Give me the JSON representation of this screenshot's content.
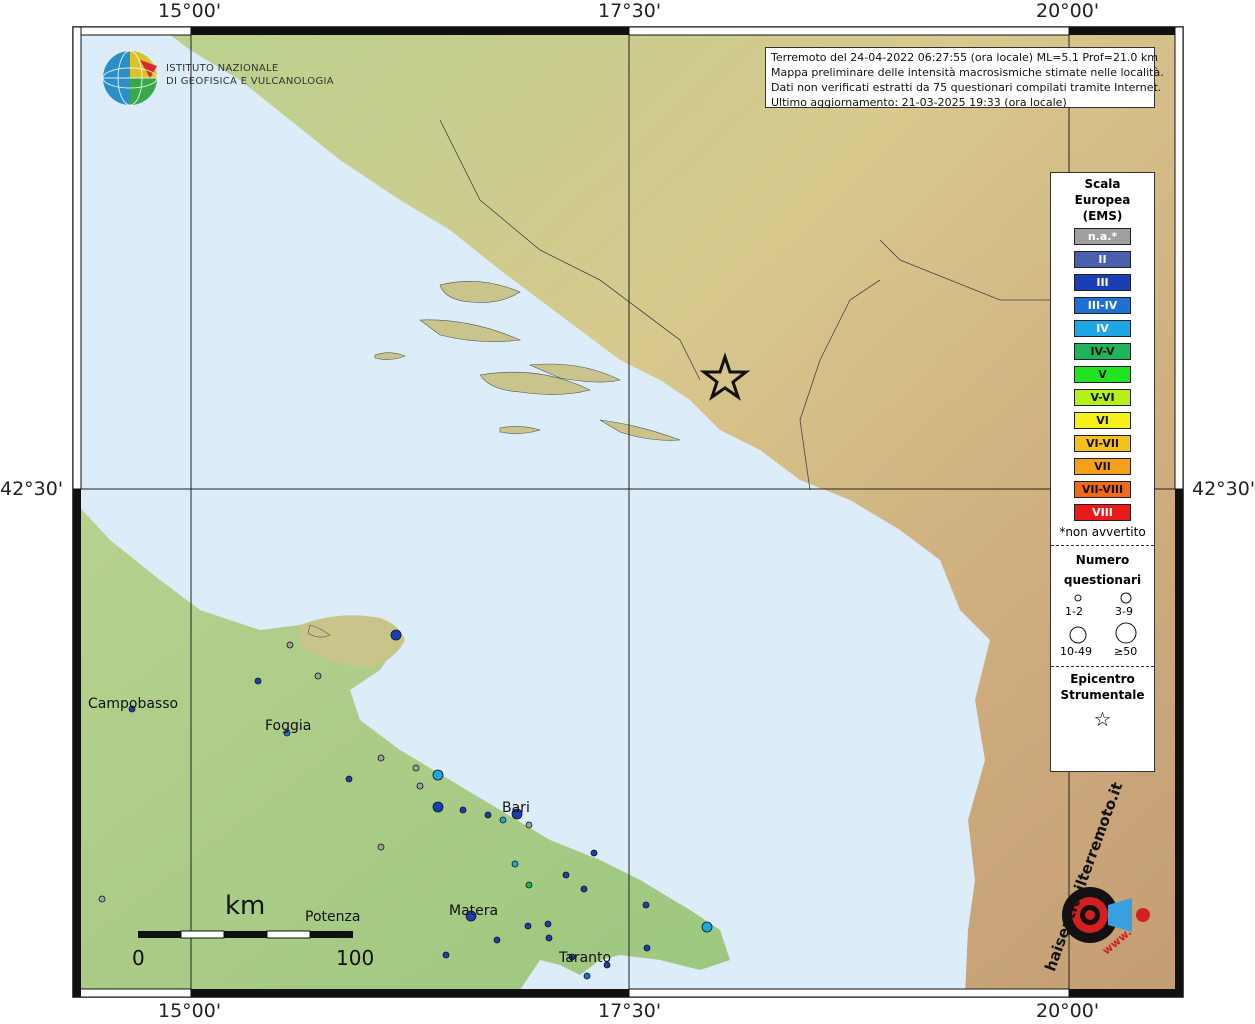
{
  "coords": {
    "top": [
      "15°00'",
      "17°30'",
      "20°00'"
    ],
    "bottom": [
      "15°00'",
      "17°30'",
      "20°00'"
    ],
    "left": "42°30'",
    "right": "42°30'"
  },
  "logo": {
    "line1": "ISTITUTO NAZIONALE",
    "line2": "DI GEOFISICA E VULCANOLOGIA"
  },
  "info": {
    "line1": "Terremoto del 24-04-2022 06:27:55 (ora locale) ML=5.1 Prof=21.0 km",
    "line2": "Mappa preliminare delle intensità macrosismiche stimate nelle località.",
    "line3": "Dati non verificati estratti da 75 questionari compilati tramite Internet.",
    "line4": "Ultimo aggiornamento: 21-03-2025 19:33 (ora locale)"
  },
  "legend": {
    "title1": "Scala",
    "title2": "Europea",
    "title3": "(EMS)",
    "classes": [
      {
        "label": "n.a.*",
        "color": "#a0a0a0",
        "text": "#fff"
      },
      {
        "label": "II",
        "color": "#4a5fae",
        "text": "#fff"
      },
      {
        "label": "III",
        "color": "#1a3fb5",
        "text": "#fff"
      },
      {
        "label": "III-IV",
        "color": "#1f70d6",
        "text": "#fff"
      },
      {
        "label": "IV",
        "color": "#1fa6e6",
        "text": "#fff"
      },
      {
        "label": "IV-V",
        "color": "#1fb35a",
        "text": "#111"
      },
      {
        "label": "V",
        "color": "#22e322",
        "text": "#111"
      },
      {
        "label": "V-VI",
        "color": "#b5f01a",
        "text": "#111"
      },
      {
        "label": "VI",
        "color": "#f5f01a",
        "text": "#111"
      },
      {
        "label": "VI-VII",
        "color": "#f5c21a",
        "text": "#111"
      },
      {
        "label": "VII",
        "color": "#f5a01a",
        "text": "#111"
      },
      {
        "label": "VII-VIII",
        "color": "#f06a1a",
        "text": "#111"
      },
      {
        "label": "VIII",
        "color": "#e81a1a",
        "text": "#fff"
      }
    ],
    "not_felt": "*non avvertito",
    "count_title1": "Numero",
    "count_title2": "questionari",
    "count_1": "1-2",
    "count_2": "3-9",
    "count_3": "10-49",
    "count_4": "≥50",
    "epi_title1": "Epicentro",
    "epi_title2": "Strumentale",
    "epi_symbol": "☆"
  },
  "cities": {
    "campobasso": "Campobasso",
    "foggia": "Foggia",
    "bari": "Bari",
    "matera": "Matera",
    "potenza": "Potenza",
    "taranto": "Taranto"
  },
  "scalebar": {
    "unit": "km",
    "min": "0",
    "max": "100"
  },
  "brand": {
    "text": "haisentitoilterremoto.it",
    "url": "www."
  },
  "colors": {
    "sea": "#dcebf7",
    "land_low": "#a8cf88",
    "land_mid": "#d7c98c",
    "land_high": "#c9a878"
  }
}
